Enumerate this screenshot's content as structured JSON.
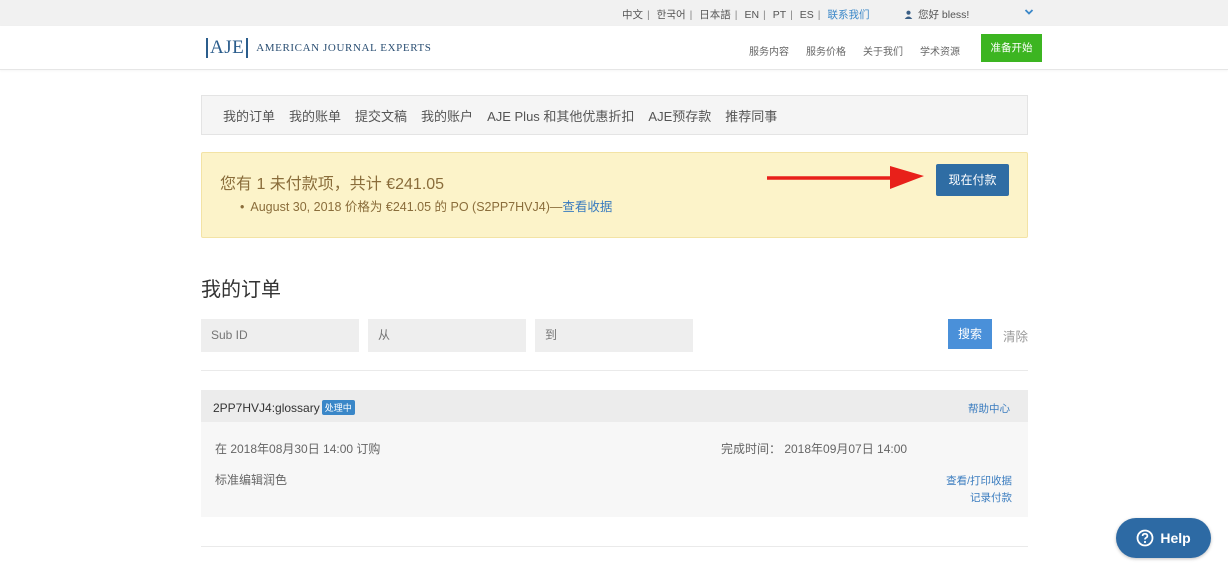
{
  "topbar": {
    "languages": [
      "中文",
      "한국어",
      "日本語",
      "EN",
      "PT",
      "ES"
    ],
    "contact": "联系我们",
    "greeting": "您好 bless!"
  },
  "header": {
    "logo_mark": "AJE",
    "logo_text": "American Journal Experts",
    "nav": [
      "服务内容",
      "服务价格",
      "关于我们",
      "学术资源"
    ],
    "start_button": "准备开始"
  },
  "account_nav": [
    "我的订单",
    "我的账单",
    "提交文稿",
    "我的账户",
    "AJE Plus 和其他优惠折扣",
    "AJE预存款",
    "推荐同事"
  ],
  "alert": {
    "title": "您有 1 未付款项，共计 €241.05",
    "item_text": "August 30, 2018 价格为 €241.05 的 PO (S2PP7HVJ4)—",
    "item_link": "查看收据",
    "pay_button": "现在付款"
  },
  "orders": {
    "title": "我的订单",
    "search": {
      "sub_id_placeholder": "Sub ID",
      "from_placeholder": "从",
      "to_placeholder": "到",
      "search_button": "搜索",
      "clear_link": "清除"
    },
    "items": [
      {
        "id": "2PP7HVJ4:glossary",
        "status": "处理中",
        "help_link": "帮助中心",
        "ordered": "在 2018年08月30日 14:00 订购",
        "completed": "完成时间： 2018年09月07日 14:00",
        "service": "标准编辑润色",
        "view_receipt": "查看/打印收据",
        "record_payment": "记录付款"
      }
    ]
  },
  "help_fab": {
    "label": "Help"
  },
  "colors": {
    "accent": "#2f6da4",
    "start_green": "#3cb521",
    "alert_bg": "#fcf3c9",
    "arrow": "#e8201a"
  }
}
